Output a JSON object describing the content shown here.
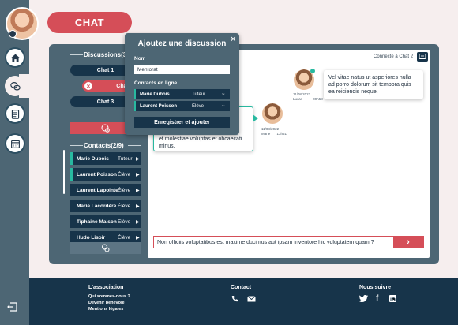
{
  "header": {
    "title": "CHAT"
  },
  "discussions": {
    "title": "Discussions(3",
    "items": [
      {
        "label": "Chat 1",
        "active": false
      },
      {
        "label": "Chat 2",
        "active": true
      },
      {
        "label": "Chat 3",
        "active": false
      }
    ]
  },
  "contacts": {
    "title": "Contacts(2/9)",
    "items": [
      {
        "name": "Marie Dubois",
        "role": "Tuteur"
      },
      {
        "name": "Laurent Poisson",
        "role": "Élève"
      },
      {
        "name": "Laurent Lapointe",
        "role": "Élève"
      },
      {
        "name": "Marie Lacordère",
        "role": "Élève"
      },
      {
        "name": "Tiphaine Maison",
        "role": "Élève"
      },
      {
        "name": "Hudo Lisoir",
        "role": "Élève"
      }
    ]
  },
  "chat": {
    "connected": "Connecté à Chat 2",
    "messages": [
      {
        "text": "Vel vitae natus ut asperiores nulla ad porro dolorum sit tempora quis ea reiciendis neque.",
        "date": "11/08/2022",
        "author": "Lucas",
        "time": "09h58"
      },
      {
        "text": "et molestiae voluptas et obcaecati minus.",
        "date": "11/08/2022",
        "author": "Marie",
        "time": "13h51"
      }
    ],
    "input_value": "Non officiis voluptatibus est maxime ducimus aut ipsam inventore hic voluptatem quam ?",
    "send_label": "›"
  },
  "modal": {
    "title": "Ajoutez une discussion",
    "name_label": "Nom",
    "name_value": "Mentorat",
    "online_label": "Contacts en ligne",
    "online": [
      {
        "name": "Marie Dubois",
        "role": "Tuteur"
      },
      {
        "name": "Laurent Poisson",
        "role": "Élève"
      }
    ],
    "save_label": "Enregistrer et ajouter"
  },
  "footer": {
    "association": {
      "title": "L'association",
      "links": [
        "Qui sommes-nous ?",
        "Devenir bénévole",
        "Mentions légales"
      ]
    },
    "contact": {
      "title": "Contact"
    },
    "follow": {
      "title": "Nous suivre"
    }
  },
  "colors": {
    "accent": "#d54e58",
    "navy": "#17344a",
    "slate": "#4d6674",
    "teal": "#28b9a0",
    "background": "#f6eeee"
  }
}
